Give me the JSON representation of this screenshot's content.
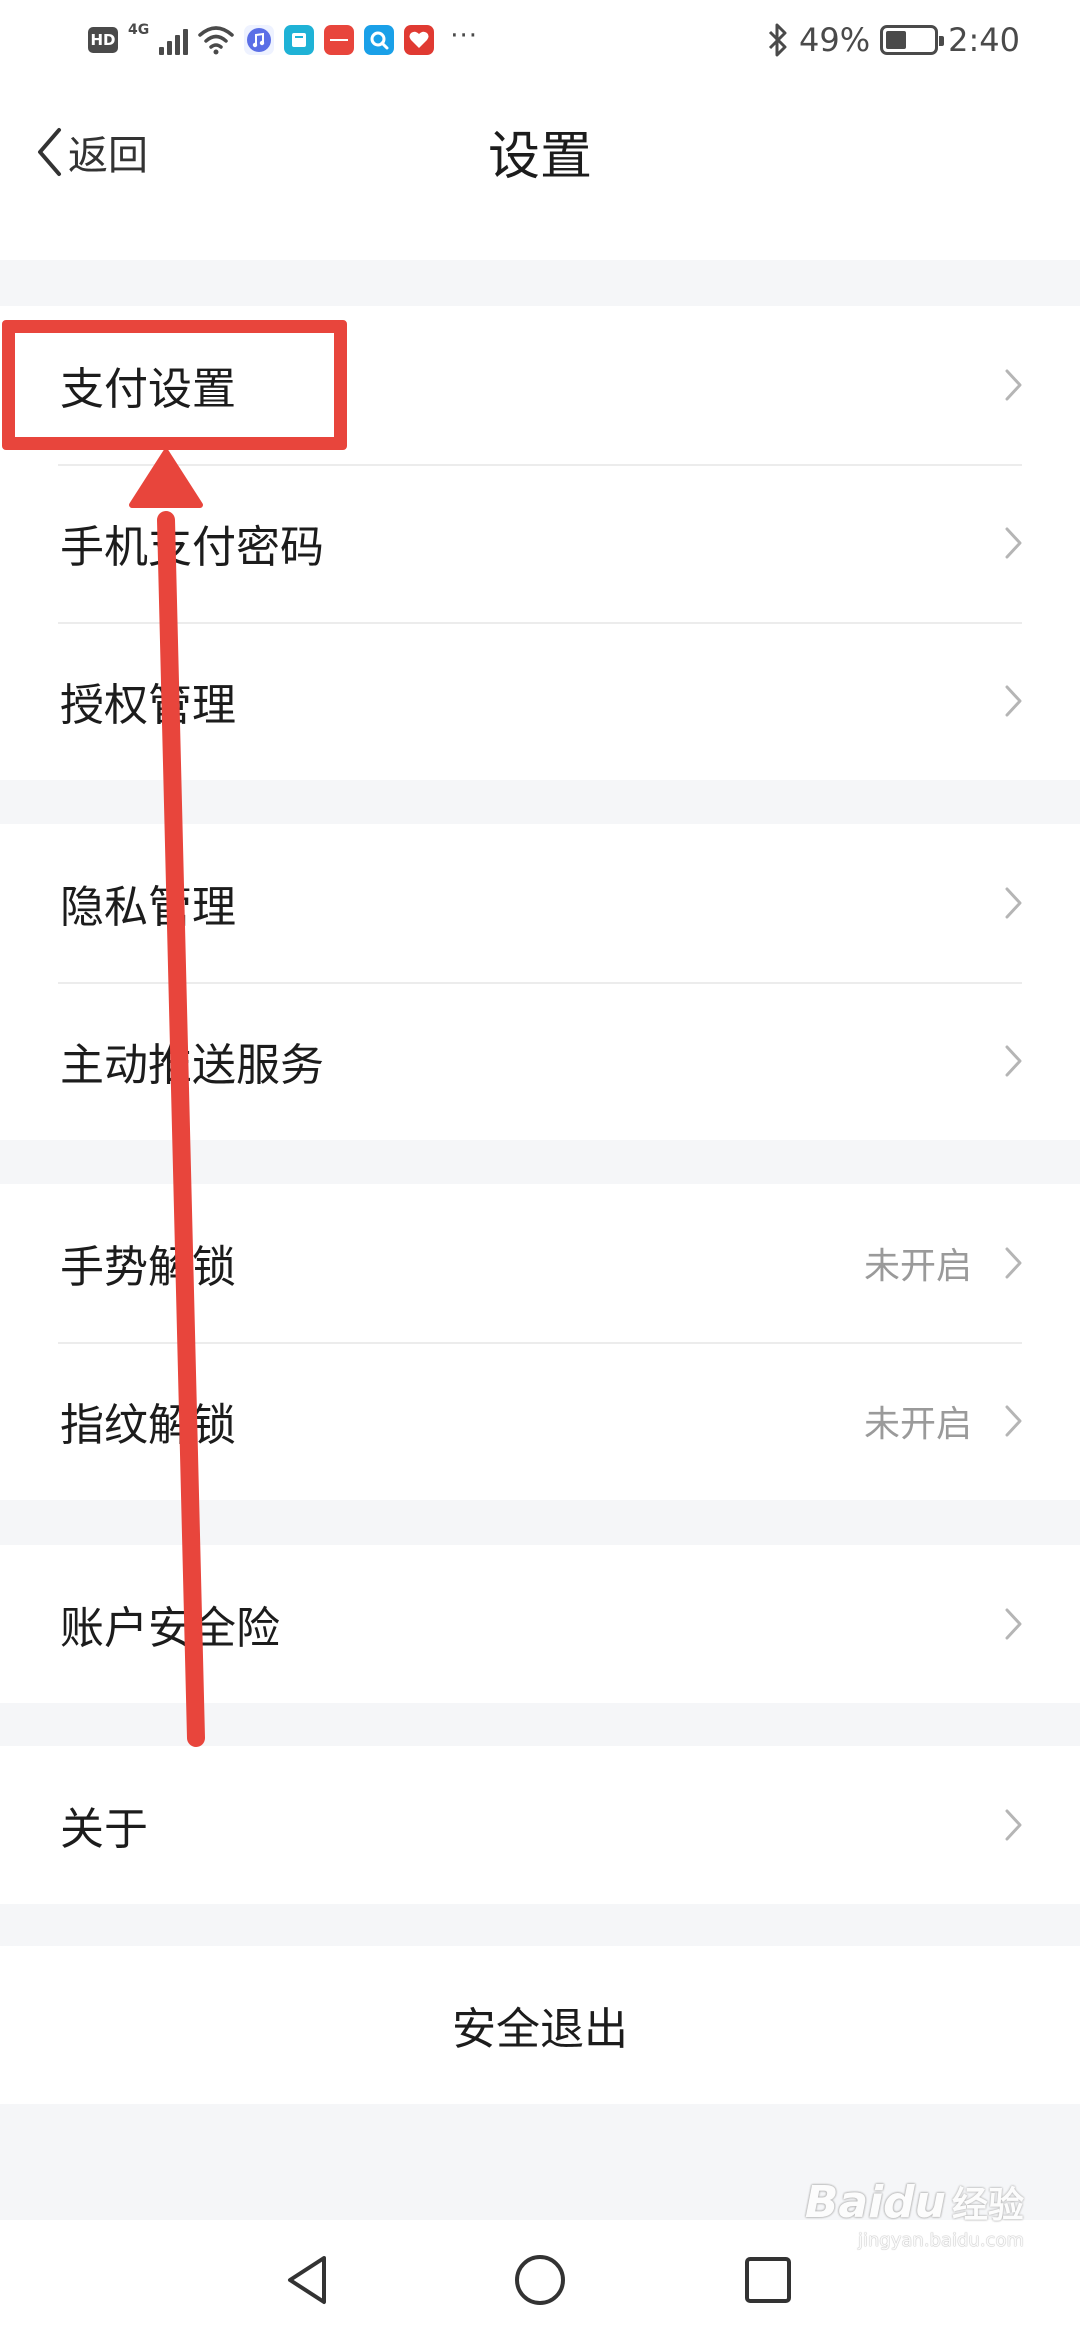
{
  "status_bar": {
    "hd": "HD",
    "network": "4G",
    "battery_percent": "49%",
    "battery_level": 0.49,
    "time": "2:40",
    "icons": [
      "hd-icon",
      "signal-icon",
      "wifi-icon",
      "music-icon",
      "book-icon",
      "huawei-icon",
      "search-app-icon",
      "heart-app-icon",
      "more-icon",
      "bluetooth-icon",
      "battery-icon"
    ]
  },
  "header": {
    "back_label": "返回",
    "title": "设置"
  },
  "groups": [
    {
      "items": [
        {
          "label": "支付设置",
          "value": ""
        },
        {
          "label": "手机支付密码",
          "value": ""
        },
        {
          "label": "授权管理",
          "value": ""
        }
      ]
    },
    {
      "items": [
        {
          "label": "隐私管理",
          "value": ""
        },
        {
          "label": "主动推送服务",
          "value": ""
        }
      ]
    },
    {
      "items": [
        {
          "label": "手势解锁",
          "value": "未开启"
        },
        {
          "label": "指纹解锁",
          "value": "未开启"
        }
      ]
    },
    {
      "items": [
        {
          "label": "账户安全险",
          "value": ""
        }
      ]
    },
    {
      "items": [
        {
          "label": "关于",
          "value": ""
        }
      ]
    }
  ],
  "logout": {
    "label": "安全退出"
  },
  "system_nav": [
    "back-triangle-icon",
    "home-circle-icon",
    "recents-square-icon"
  ],
  "annotation": {
    "color": "#e8453c"
  },
  "watermark": {
    "logo": "Baidu",
    "cn": "经验",
    "url": "jingyan.baidu.com"
  }
}
